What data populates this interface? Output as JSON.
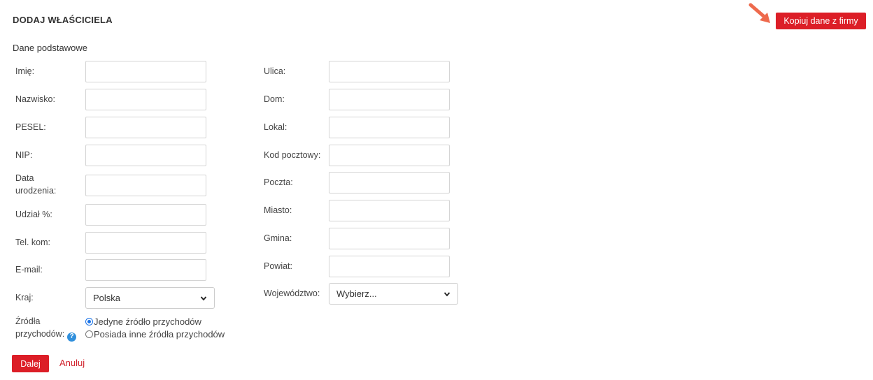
{
  "header": {
    "title": "DODAJ WŁAŚCICIELA",
    "copy_button": "Kopiuj dane z firmy"
  },
  "section": {
    "basic": "Dane podstawowe"
  },
  "left_fields": [
    {
      "label": "Imię:",
      "value": ""
    },
    {
      "label": "Nazwisko:",
      "value": ""
    },
    {
      "label": "PESEL:",
      "value": ""
    },
    {
      "label": "NIP:",
      "value": ""
    },
    {
      "label_line1": "Data",
      "label_line2": "urodzenia:",
      "value": ""
    },
    {
      "label": "Udział %:",
      "value": ""
    },
    {
      "label": "Tel. kom:",
      "value": ""
    },
    {
      "label": "E-mail:",
      "value": ""
    }
  ],
  "right_fields": [
    {
      "label": "Ulica:",
      "value": ""
    },
    {
      "label": "Dom:",
      "value": ""
    },
    {
      "label": "Lokal:",
      "value": ""
    },
    {
      "label": "Kod pocztowy:",
      "value": ""
    },
    {
      "label": "Poczta:",
      "value": ""
    },
    {
      "label": "Miasto:",
      "value": ""
    },
    {
      "label": "Gmina:",
      "value": ""
    },
    {
      "label": "Powiat:",
      "value": ""
    }
  ],
  "country": {
    "label": "Kraj:",
    "selected": "Polska"
  },
  "voivodeship": {
    "label": "Województwo:",
    "selected": "Wybierz..."
  },
  "income": {
    "label_line1": "Źródła",
    "label_line2": "przychodów:",
    "help_glyph": "?",
    "options": [
      "Jedyne źródło przychodów",
      "Posiada inne źródła przychodów"
    ],
    "selected_index": 0
  },
  "actions": {
    "next": "Dalej",
    "cancel": "Anuluj"
  },
  "colors": {
    "accent": "#dc1e27",
    "link": "#d0202a",
    "arrow": "#ee6a4d",
    "help": "#2f8fdc"
  },
  "icons": {
    "arrow": "pointer-arrow-icon",
    "help": "help-icon",
    "dropdown": "chevron-down-icon"
  }
}
